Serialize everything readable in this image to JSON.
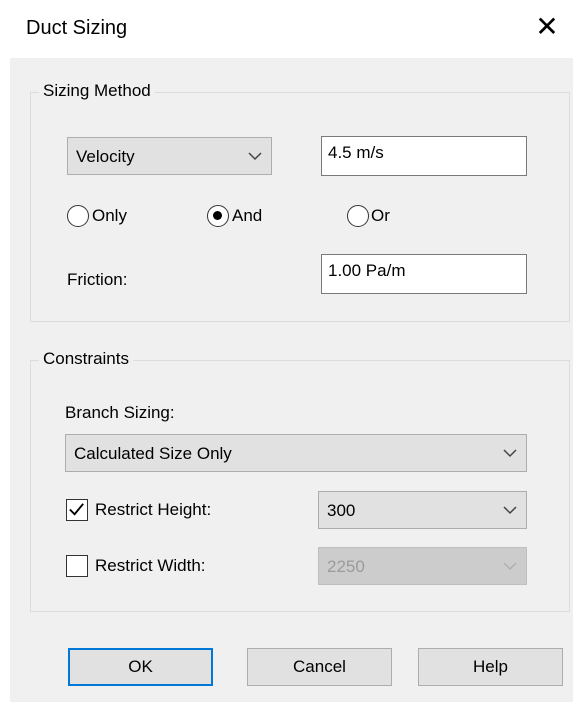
{
  "window": {
    "title": "Duct Sizing",
    "close_glyph": "✕"
  },
  "sizing_method": {
    "legend": "Sizing Method",
    "method_select": {
      "value": "Velocity"
    },
    "velocity_field": {
      "value": "4.5 m/s"
    },
    "radios": [
      {
        "label": "Only",
        "checked": false
      },
      {
        "label": "And",
        "checked": true
      },
      {
        "label": "Or",
        "checked": false
      }
    ],
    "friction_label": "Friction:",
    "friction_field": {
      "value": "1.00 Pa/m"
    }
  },
  "constraints": {
    "legend": "Constraints",
    "branch_sizing_label": "Branch Sizing:",
    "branch_sizing_select": {
      "value": "Calculated Size Only"
    },
    "restrict_height": {
      "label": "Restrict Height:",
      "checked": true,
      "value": "300"
    },
    "restrict_width": {
      "label": "Restrict Width:",
      "checked": false,
      "value": "2250",
      "disabled": true
    }
  },
  "buttons": {
    "ok": "OK",
    "cancel": "Cancel",
    "help": "Help"
  },
  "colors": {
    "dialog_bg": "#f0f0f0",
    "button_bg": "#e1e1e1",
    "focus_border": "#0078d7",
    "disabled_text": "#9b9b9b"
  },
  "icons": {
    "close": "close-icon",
    "dropdown": "chevron-down-icon",
    "check": "checkmark-icon"
  }
}
